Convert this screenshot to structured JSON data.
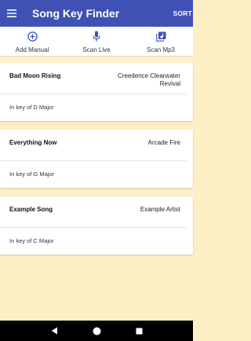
{
  "app": {
    "title": "Song Key Finder",
    "sort_label": "SORT",
    "primary_color": "#3f51b5",
    "background_color": "#fdf0c6"
  },
  "toolbar": {
    "items": [
      {
        "label": "Add Manual",
        "icon": "add-circle-icon"
      },
      {
        "label": "Scan Live",
        "icon": "microphone-icon"
      },
      {
        "label": "Scan Mp3",
        "icon": "music-library-icon"
      }
    ]
  },
  "songs": [
    {
      "title": "Bad Moon Rising",
      "artist": "Creedence Clearwater Revival",
      "key": "In key of D Major"
    },
    {
      "title": "Everything Now",
      "artist": "Arcade Fire",
      "key": "In key of G Major"
    },
    {
      "title": "Example Song",
      "artist": "Example Artist",
      "key": "In key of C Major"
    }
  ],
  "navbar": {
    "buttons": [
      "back-icon",
      "home-icon",
      "recents-icon"
    ]
  }
}
